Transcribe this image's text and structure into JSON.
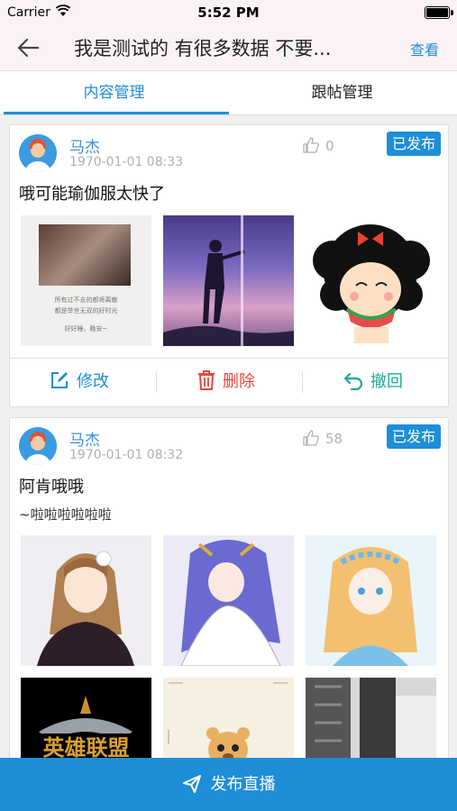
{
  "status": {
    "carrier": "Carrier",
    "time": "5:52 PM"
  },
  "nav": {
    "title": "我是测试的 有很多数据  不要...",
    "view_label": "查看"
  },
  "tabs": [
    {
      "label": "内容管理",
      "active": true
    },
    {
      "label": "跟帖管理",
      "active": false
    }
  ],
  "posts": [
    {
      "author": "马杰",
      "date": "1970-01-01 08:33",
      "likes": "0",
      "status": "已发布",
      "title": "哦可能瑜伽服太快了",
      "images": [
        {
          "icon": "flower-photo-image",
          "caption_lines": [
            "所有过不去的都将离散",
            "都是举世无双的好时光",
            "好好睡，晚安~"
          ]
        },
        {
          "icon": "anime-silhouette-image"
        },
        {
          "icon": "cartoon-girl-watermelon-image"
        }
      ],
      "actions": {
        "edit": "修改",
        "delete": "删除",
        "revoke": "撤回"
      }
    },
    {
      "author": "马杰",
      "date": "1970-01-01 08:32",
      "likes": "58",
      "status": "已发布",
      "title": "阿肯哦哦",
      "subtitle": "~啦啦啦啦啦啦",
      "images": [
        {
          "icon": "anime-girl-brown-hair-image"
        },
        {
          "icon": "anime-girl-purple-image"
        },
        {
          "icon": "anime-girl-flower-crown-image"
        },
        {
          "icon": "league-of-legends-logo-image",
          "logo_text": "英雄联盟"
        },
        {
          "icon": "bear-toy-image"
        },
        {
          "icon": "keyboard-photo-image"
        }
      ]
    }
  ],
  "bottom": {
    "publish_label": "发布直播"
  },
  "colors": {
    "accent": "#1e8ed8",
    "delete": "#e8453c",
    "revoke": "#1ea99a",
    "background": "#f0f0f0"
  }
}
